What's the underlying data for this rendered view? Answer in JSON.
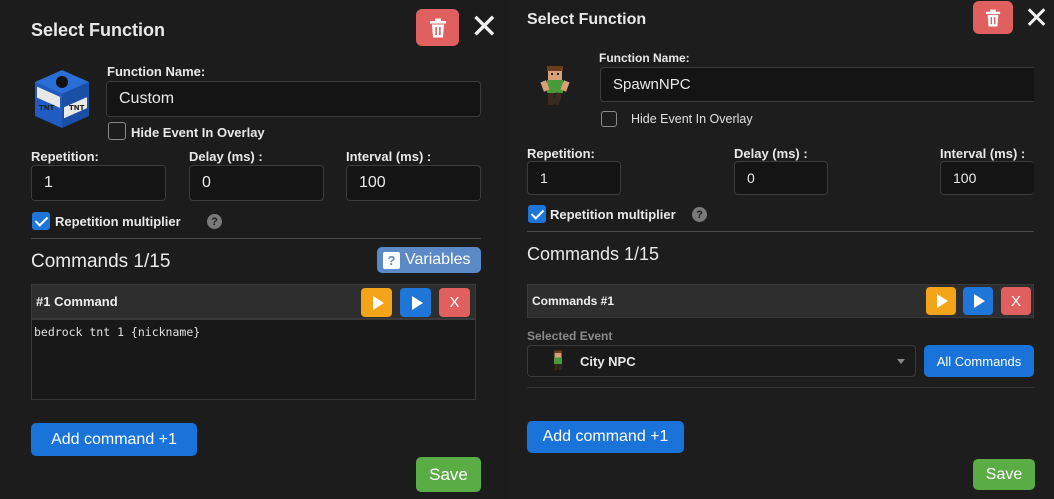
{
  "left": {
    "title": "Select Function",
    "function_name_label": "Function Name:",
    "function_name_value": "Custom",
    "hide_event_label": "Hide Event In Overlay",
    "hide_event_checked": false,
    "repetition_label": "Repetition:",
    "repetition_value": "1",
    "delay_label": "Delay (ms) :",
    "delay_value": "0",
    "interval_label": "Interval (ms) :",
    "interval_value": "100",
    "rep_multiplier_label": "Repetition multiplier",
    "rep_multiplier_checked": true,
    "commands_heading": "Commands 1/15",
    "variables_label": "Variables",
    "command_header": "#1 Command",
    "command_text": "bedrock tnt 1 {nickname}",
    "delete_command_label": "X",
    "add_command_label": "Add command +1",
    "save_label": "Save",
    "help_glyph": "?",
    "icon": "tnt-block-icon"
  },
  "right": {
    "title": "Select Function",
    "function_name_label": "Function Name:",
    "function_name_value": "SpawnNPC",
    "hide_event_label": "Hide Event In Overlay",
    "hide_event_checked": false,
    "repetition_label": "Repetition:",
    "repetition_value": "1",
    "delay_label": "Delay (ms) :",
    "delay_value": "0",
    "interval_label": "Interval (ms) :",
    "interval_value": "100",
    "rep_multiplier_label": "Repetition multiplier",
    "rep_multiplier_checked": true,
    "commands_heading": "Commands 1/15",
    "command_header": "Commands #1",
    "delete_command_label": "X",
    "selected_event_label": "Selected Event",
    "selected_event_value": "City NPC",
    "all_commands_label": "All Commands",
    "add_command_label": "Add command +1",
    "save_label": "Save",
    "help_glyph": "?",
    "icon": "npc-character-icon"
  },
  "colors": {
    "background": "#1c1c1c",
    "danger": "#e06060",
    "primary": "#1a73d9",
    "play_orange": "#f4a418",
    "save_green": "#5aac44",
    "variables_blue": "#5b8ac7"
  }
}
